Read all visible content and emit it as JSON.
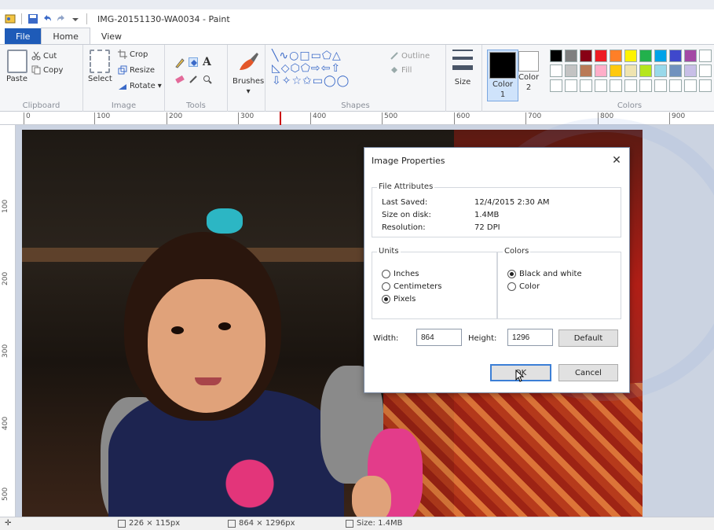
{
  "window": {
    "title": "IMG-20151130-WA0034 - Paint"
  },
  "quick_access": {
    "icons": [
      "paint-app-icon",
      "save-icon",
      "undo-icon",
      "redo-icon",
      "customize-dropdown-icon"
    ]
  },
  "tabs": [
    {
      "label": "File"
    },
    {
      "label": "Home"
    },
    {
      "label": "View"
    }
  ],
  "ribbon": {
    "clipboard": {
      "label": "Clipboard",
      "paste": "Paste",
      "cut": "Cut",
      "copy": "Copy"
    },
    "image": {
      "label": "Image",
      "select": "Select",
      "crop": "Crop",
      "resize": "Resize",
      "rotate": "Rotate"
    },
    "tools": {
      "label": "Tools"
    },
    "brushes": {
      "label": "Brushes"
    },
    "shapes": {
      "label": "Shapes",
      "outline": "Outline",
      "fill": "Fill"
    },
    "size": {
      "label": "Size"
    },
    "color1": {
      "label": "Color",
      "num": "1"
    },
    "color2": {
      "label": "Color",
      "num": "2"
    },
    "colors": {
      "label": "Colors"
    },
    "palette": [
      "#000000",
      "#7f7f7f",
      "#880015",
      "#ed1c24",
      "#ff7f27",
      "#fff200",
      "#22b14c",
      "#00a2e8",
      "#3f48cc",
      "#a349a4",
      "#ffffff",
      "#ffffff",
      "#c3c3c3",
      "#b97a57",
      "#ffaec9",
      "#ffc90e",
      "#efe4b0",
      "#b5e61d",
      "#99d9ea",
      "#7092be",
      "#c8bfe7",
      "#ffffff",
      "#ffffff",
      "#ffffff",
      "#ffffff",
      "#ffffff",
      "#ffffff",
      "#ffffff",
      "#ffffff",
      "#ffffff",
      "#ffffff",
      "#ffffff",
      "#ffffff"
    ]
  },
  "ruler": {
    "top": [
      "0",
      "100",
      "200",
      "300",
      "400",
      "500",
      "600",
      "700",
      "800",
      "900"
    ],
    "left": [
      "100",
      "200",
      "300",
      "400",
      "500"
    ]
  },
  "dialog": {
    "title": "Image Properties",
    "file_attributes": {
      "legend": "File Attributes",
      "last_saved_label": "Last Saved:",
      "last_saved_value": "12/4/2015 2:30 AM",
      "size_label": "Size on disk:",
      "size_value": "1.4MB",
      "resolution_label": "Resolution:",
      "resolution_value": "72 DPI"
    },
    "units": {
      "legend": "Units",
      "options": [
        "Inches",
        "Centimeters",
        "Pixels"
      ],
      "selected": "Pixels"
    },
    "colors": {
      "legend": "Colors",
      "options": [
        "Black and white",
        "Color"
      ],
      "selected": "Black and white"
    },
    "width_label": "Width:",
    "width_value": "864",
    "height_label": "Height:",
    "height_value": "1296",
    "default_button": "Default",
    "ok_button": "OK",
    "cancel_button": "Cancel"
  },
  "statusbar": {
    "selection_size": "226 × 115px",
    "image_size": "864 × 1296px",
    "file_size": "Size: 1.4MB"
  }
}
